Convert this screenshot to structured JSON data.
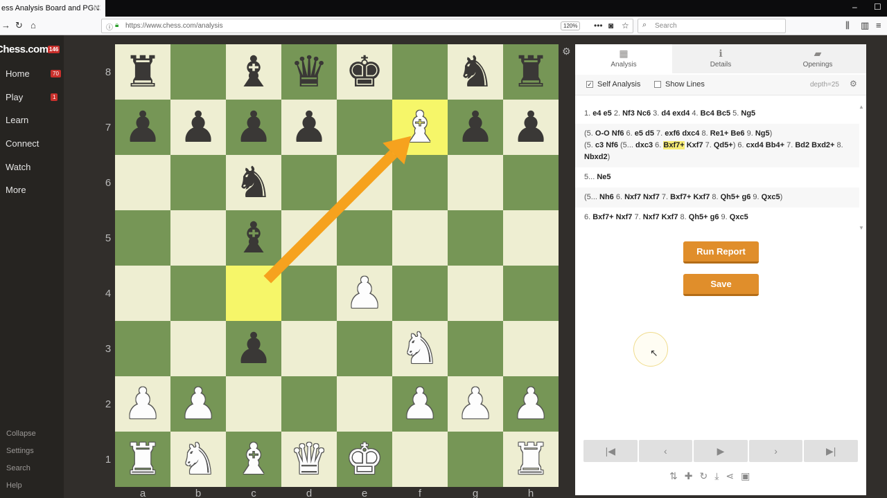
{
  "browser": {
    "tab_title": "ess Analysis Board and PGN",
    "tab_close": "✕",
    "new_tab": "+",
    "url": "https://www.chess.com/analysis",
    "zoom": "120%",
    "search_placeholder": "Search",
    "window_controls": [
      "–",
      "☐",
      "✕"
    ]
  },
  "sidebar": {
    "logo": "Chess.com",
    "logo_badge": "146",
    "items": [
      {
        "label": "Home",
        "badge": "70"
      },
      {
        "label": "Play",
        "badge": "1"
      },
      {
        "label": "Learn",
        "badge": ""
      },
      {
        "label": "Connect",
        "badge": ""
      },
      {
        "label": "Watch",
        "badge": ""
      },
      {
        "label": "More",
        "badge": ""
      }
    ],
    "bottom": [
      "Collapse",
      "Settings",
      "Search",
      "Help"
    ]
  },
  "board": {
    "ranks": [
      "8",
      "7",
      "6",
      "5",
      "4",
      "3",
      "2",
      "1"
    ],
    "files": [
      "a",
      "b",
      "c",
      "d",
      "e",
      "f",
      "g",
      "h"
    ],
    "highlight_squares": [
      "c4",
      "f7"
    ],
    "arrow": {
      "from": "c4",
      "to": "f7",
      "color": "#f6a21e"
    },
    "pieces": {
      "a8": "br",
      "c8": "bb",
      "d8": "bq",
      "e8": "bk",
      "g8": "bn",
      "h8": "br",
      "a7": "bp",
      "b7": "bp",
      "c7": "bp",
      "d7": "bp",
      "f7": "wb",
      "g7": "bp",
      "h7": "bp",
      "c6": "bn",
      "c5": "bb",
      "e4": "wp",
      "c3": "bp",
      "f3": "wn",
      "a2": "wp",
      "b2": "wp",
      "f2": "wp",
      "g2": "wp",
      "h2": "wp",
      "a1": "wr",
      "b1": "wn",
      "c1": "wb",
      "d1": "wq",
      "e1": "wk",
      "h1": "wr"
    }
  },
  "panel": {
    "tabs": [
      {
        "label": "Analysis",
        "icon": "analysis-icon"
      },
      {
        "label": "Details",
        "icon": "info-icon"
      },
      {
        "label": "Openings",
        "icon": "book-icon"
      }
    ],
    "self_analysis": "Self Analysis",
    "show_lines": "Show Lines",
    "depth": "depth=25",
    "run_report": "Run Report",
    "save": "Save"
  }
}
